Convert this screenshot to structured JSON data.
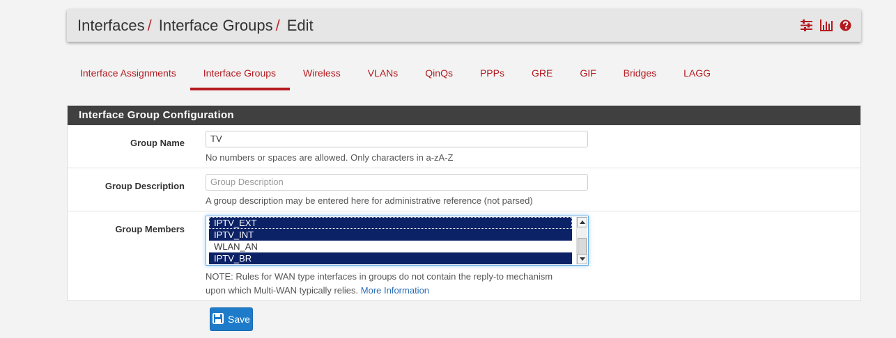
{
  "breadcrumb": [
    "Interfaces",
    "Interface Groups",
    "Edit"
  ],
  "breadcrumb_separator": "/",
  "header_icons": [
    "sliders-icon",
    "bar-chart-icon",
    "help-circle-icon"
  ],
  "tabs": [
    {
      "label": "Interface Assignments",
      "active": false
    },
    {
      "label": "Interface Groups",
      "active": true
    },
    {
      "label": "Wireless",
      "active": false
    },
    {
      "label": "VLANs",
      "active": false
    },
    {
      "label": "QinQs",
      "active": false
    },
    {
      "label": "PPPs",
      "active": false
    },
    {
      "label": "GRE",
      "active": false
    },
    {
      "label": "GIF",
      "active": false
    },
    {
      "label": "Bridges",
      "active": false
    },
    {
      "label": "LAGG",
      "active": false
    }
  ],
  "panel": {
    "title": "Interface Group Configuration",
    "group_name": {
      "label": "Group Name",
      "value": "TV",
      "help": "No numbers or spaces are allowed. Only characters in a-zA-Z"
    },
    "group_description": {
      "label": "Group Description",
      "value": "",
      "placeholder": "Group Description",
      "help": "A group description may be entered here for administrative reference (not parsed)"
    },
    "group_members": {
      "label": "Group Members",
      "options": [
        {
          "label": "IPTV_EXT",
          "selected": true
        },
        {
          "label": "IPTV_INT",
          "selected": true
        },
        {
          "label": "WLAN_AN",
          "selected": false
        },
        {
          "label": "IPTV_BR",
          "selected": true
        }
      ],
      "note_line1": "NOTE: Rules for WAN type interfaces in groups do not contain the reply-to mechanism",
      "note_line2": "upon which Multi-WAN typically relies.",
      "more_info_link": "More Information"
    }
  },
  "save_button": {
    "label": "Save"
  },
  "colors": {
    "accent": "#b31b20",
    "selected_option": "#0c2266",
    "primary_button": "#1e7bc9",
    "panel_heading": "#404040"
  }
}
